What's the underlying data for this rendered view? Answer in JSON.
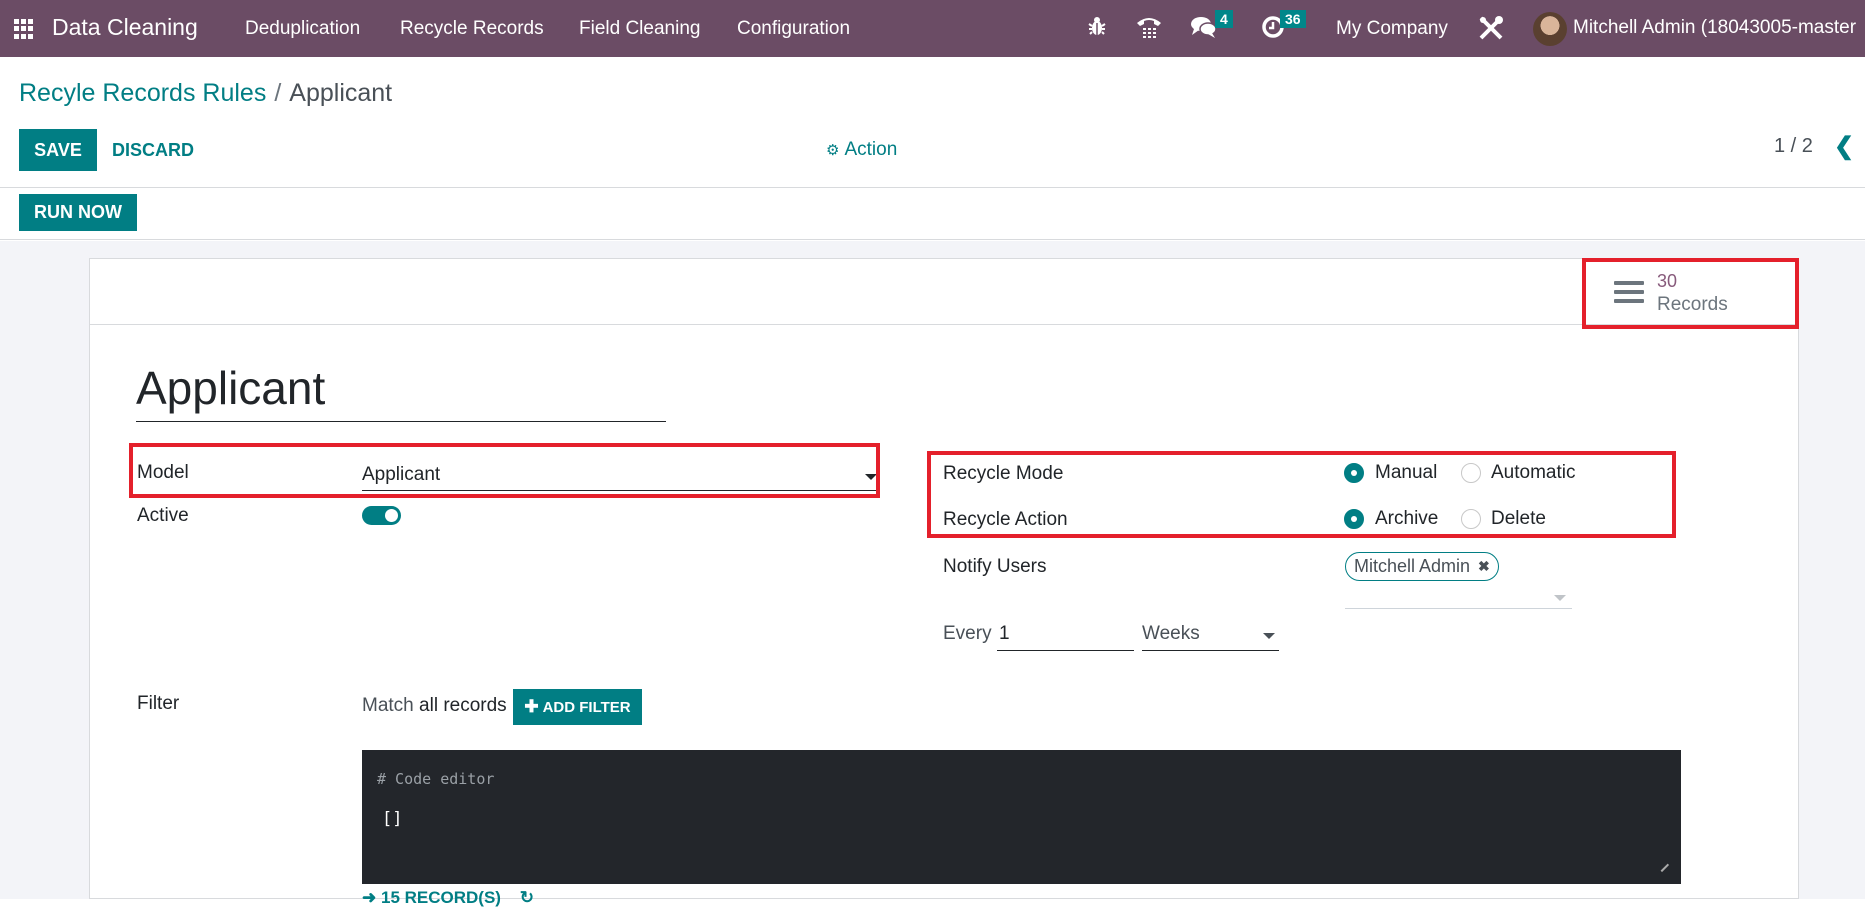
{
  "navbar": {
    "app_name": "Data Cleaning",
    "menu": [
      "Deduplication",
      "Recycle Records",
      "Field Cleaning",
      "Configuration"
    ],
    "icons": {
      "apps": "apps-grid-icon",
      "debug": "bug-icon",
      "voip": "phone-icon",
      "messages": "chat-icon",
      "activities": "clock-icon",
      "settings": "tools-icon"
    },
    "messages_count": "4",
    "activities_count": "36",
    "company": "My Company",
    "user": "Mitchell Admin (18043005-master"
  },
  "breadcrumb": {
    "parent": "Recyle Records Rules",
    "separator": "/",
    "current": "Applicant"
  },
  "toolbar": {
    "save_label": "SAVE",
    "discard_label": "DISCARD",
    "action_label": "Action",
    "pager": "1 / 2",
    "run_now_label": "RUN NOW"
  },
  "stat_button": {
    "count": "30",
    "label": "Records"
  },
  "form": {
    "name": "Applicant",
    "model_label": "Model",
    "model_value": "Applicant",
    "active_label": "Active",
    "active": true,
    "recycle_mode_label": "Recycle Mode",
    "recycle_mode_options": [
      "Manual",
      "Automatic"
    ],
    "recycle_mode_selected": "Manual",
    "recycle_action_label": "Recycle Action",
    "recycle_action_options": [
      "Archive",
      "Delete"
    ],
    "recycle_action_selected": "Archive",
    "notify_users_label": "Notify Users",
    "notify_users": [
      "Mitchell Admin"
    ],
    "every_label": "Every",
    "every_value": "1",
    "every_unit": "Weeks",
    "filter_label": "Filter",
    "filter_match_prefix": "Match",
    "filter_match_value": "all records",
    "add_filter_label": "ADD FILTER",
    "code_comment": "# Code editor",
    "code_value": "[]",
    "records_count_label": "15 RECORD(S)"
  },
  "colors": {
    "navbar": "#6b4c65",
    "primary": "#017e84",
    "highlight_box": "#e4202b",
    "code_bg": "#23262b"
  }
}
